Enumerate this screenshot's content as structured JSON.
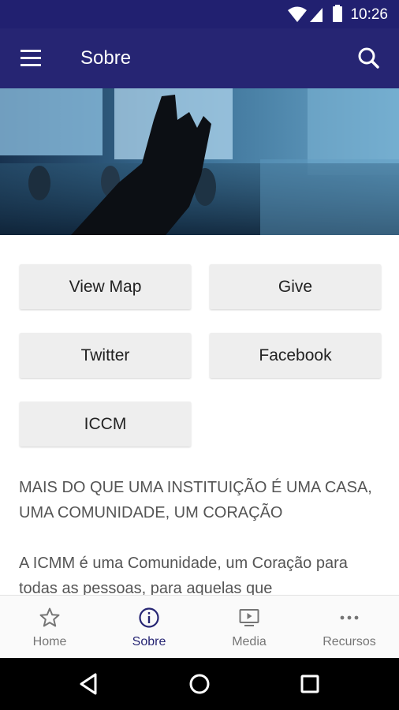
{
  "status_bar": {
    "time": "10:26",
    "wifi_icon": "wifi-icon",
    "signal_icon": "signal-icon",
    "battery_icon": "battery-icon"
  },
  "app_bar": {
    "title": "Sobre",
    "menu_icon": "hamburger-menu-icon",
    "search_icon": "search-icon",
    "background": "#262573"
  },
  "buttons": {
    "view_map": "View Map",
    "give": "Give",
    "twitter": "Twitter",
    "facebook": "Facebook",
    "iccm": "ICCM"
  },
  "description": {
    "heading": "MAIS DO QUE UMA INSTITUIÇÃO É UMA CASA, UMA COMUNIDADE, UM CORAÇÃO",
    "paragraph": "A ICMM é uma Comunidade, um Coração para todas as pessoas, para aquelas que"
  },
  "bottom_nav": {
    "items": [
      {
        "label": "Home",
        "icon": "star-icon"
      },
      {
        "label": "Sobre",
        "icon": "info-icon",
        "active": true
      },
      {
        "label": "Media",
        "icon": "media-icon"
      },
      {
        "label": "Recursos",
        "icon": "more-icon"
      }
    ]
  },
  "system_nav": {
    "back_icon": "back-icon",
    "home_icon": "home-icon",
    "recents_icon": "recents-icon"
  },
  "colors": {
    "accent": "#262573",
    "status_bar": "#212070",
    "button_bg": "#eeeeee",
    "text_muted": "#555555",
    "nav_inactive": "#757575"
  }
}
